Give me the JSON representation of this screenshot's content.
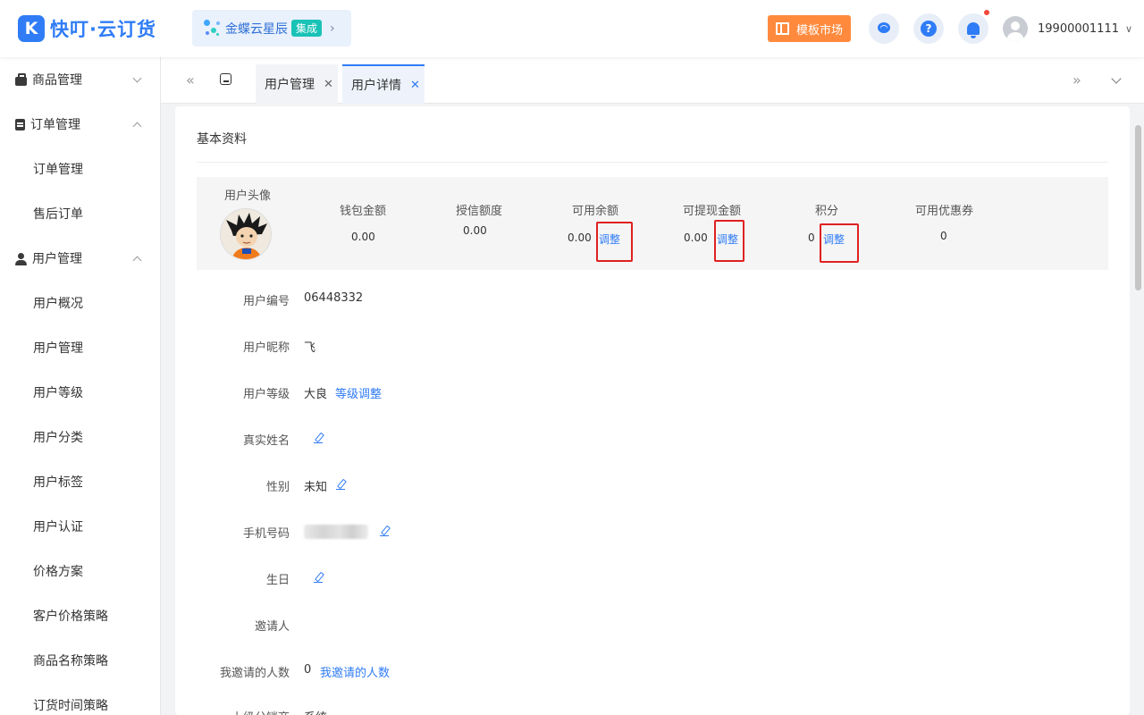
{
  "header": {
    "logo_mark": "K",
    "app_name": "快叮·云订货",
    "kd_name": "金蝶云星辰",
    "kd_tag": "集成",
    "market_label": "模板市场",
    "help_glyph": "?",
    "user_phone": "19900001111",
    "icons": [
      "logo-icon",
      "kingdee-icon",
      "template-icon",
      "service-icon",
      "help-icon",
      "bell-icon",
      "avatar-icon"
    ]
  },
  "sidebar": {
    "groups": [
      {
        "label": "商品管理",
        "icon": "bag-icon",
        "expanded": false
      },
      {
        "label": "订单管理",
        "icon": "clipboard-icon",
        "expanded": true,
        "items": [
          "订单管理",
          "售后订单"
        ]
      },
      {
        "label": "用户管理",
        "icon": "user-icon",
        "expanded": true,
        "items": [
          "用户概况",
          "用户管理",
          "用户等级",
          "用户分类",
          "用户标签",
          "用户认证",
          "价格方案",
          "客户价格策略",
          "商品名称策略",
          "订货时间策略"
        ]
      }
    ]
  },
  "tabs": {
    "items": [
      {
        "label": "用户管理",
        "active": false
      },
      {
        "label": "用户详情",
        "active": true
      }
    ],
    "accent": "#2f7cf6"
  },
  "detail": {
    "section_title": "基本资料",
    "avatar_label": "用户头像",
    "adjust_label": "调整",
    "stats": [
      {
        "label": "钱包金额",
        "value": "0.00"
      },
      {
        "label": "授信额度",
        "value": "0.00"
      },
      {
        "label": "可用余额",
        "value": "0.00",
        "adjustable": true
      },
      {
        "label": "可提现金额",
        "value": "0.00",
        "adjustable": true
      },
      {
        "label": "积分",
        "value": "0",
        "adjustable": true
      },
      {
        "label": "可用优惠券",
        "value": "0"
      }
    ],
    "fields": [
      {
        "label": "用户编号",
        "value": "06448332"
      },
      {
        "label": "用户昵称",
        "value": "飞"
      },
      {
        "label": "用户等级",
        "value": "大良",
        "link": "等级调整"
      },
      {
        "label": "真实姓名",
        "value": "",
        "editable": true
      },
      {
        "label": "性别",
        "value": "未知",
        "editable": true
      },
      {
        "label": "手机号码",
        "value": "",
        "editable": true,
        "masked": true
      },
      {
        "label": "生日",
        "value": "",
        "editable": true
      },
      {
        "label": "邀请人",
        "value": ""
      },
      {
        "label": "我邀请的人数",
        "value": "0",
        "link": "我邀请的人数"
      },
      {
        "label": "上级分销商",
        "value": "系统",
        "editable": true
      }
    ]
  },
  "colors": {
    "primary": "#2f7cf6",
    "orange": "#ff8a3d",
    "highlight": "#e02020",
    "teal": "#19c2b7"
  }
}
